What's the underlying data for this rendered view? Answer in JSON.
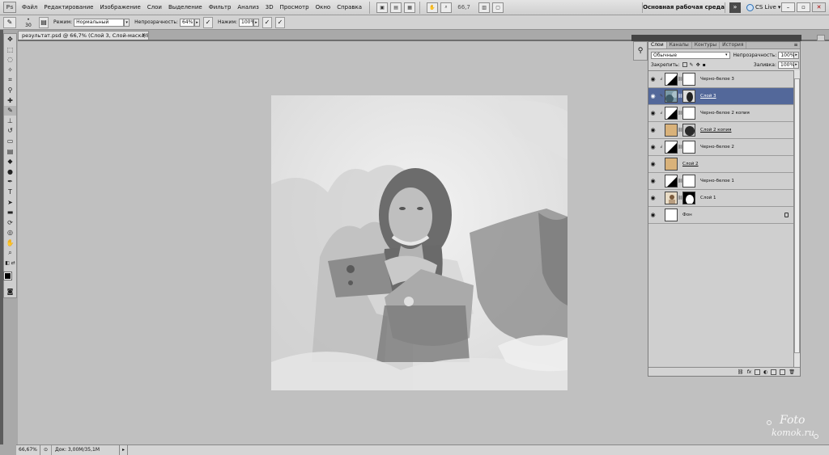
{
  "app": {
    "logo": "Ps"
  },
  "menu": [
    "Файл",
    "Редактирование",
    "Изображение",
    "Слои",
    "Выделение",
    "Фильтр",
    "Анализ",
    "3D",
    "Просмотр",
    "Окно",
    "Справка"
  ],
  "menubar": {
    "zoom": "66,7",
    "workspace": "Основная рабочая среда",
    "cs_live": "CS Live"
  },
  "options": {
    "brush_size": "30",
    "mode_label": "Режим:",
    "mode_value": "Нормальный",
    "opacity_label": "Непрозрачность:",
    "opacity_value": "64%",
    "flow_label": "Нажим:",
    "flow_value": "100%"
  },
  "document": {
    "tab_title": "результат.psd @ 66,7% (Слой 3, Слой-маска/8) *"
  },
  "layers_panel": {
    "tabs": [
      "Слои",
      "Каналы",
      "Контуры",
      "История"
    ],
    "blend_mode": "Обычные",
    "opacity_label": "Непрозрачность:",
    "opacity_value": "100%",
    "lock_label": "Закрепить:",
    "fill_label": "Заливка:",
    "fill_value": "100%",
    "layers": [
      {
        "name": "Черно-белое 3",
        "type": "adjustment",
        "selected": false
      },
      {
        "name": "Слой 3",
        "type": "image-mask",
        "selected": true
      },
      {
        "name": "Черно-белое 2 копия",
        "type": "adjustment",
        "selected": false
      },
      {
        "name": "Слой 2 копия",
        "type": "texture-mask",
        "selected": false
      },
      {
        "name": "Черно-белое 2",
        "type": "adjustment",
        "selected": false
      },
      {
        "name": "Слой 2",
        "type": "texture",
        "selected": false
      },
      {
        "name": "Черно-белое 1",
        "type": "adjustment",
        "selected": false
      },
      {
        "name": "Слой 1",
        "type": "photo-mask",
        "selected": false
      },
      {
        "name": "Фон",
        "type": "background",
        "selected": false
      }
    ]
  },
  "status": {
    "zoom": "66,67%",
    "doc": "Док: 3,00M/35,1M"
  },
  "watermark": {
    "line1": "Foto",
    "line2": "komok.ru"
  },
  "colors": {
    "selection": "#53689a",
    "texture": "#d9b27a"
  }
}
